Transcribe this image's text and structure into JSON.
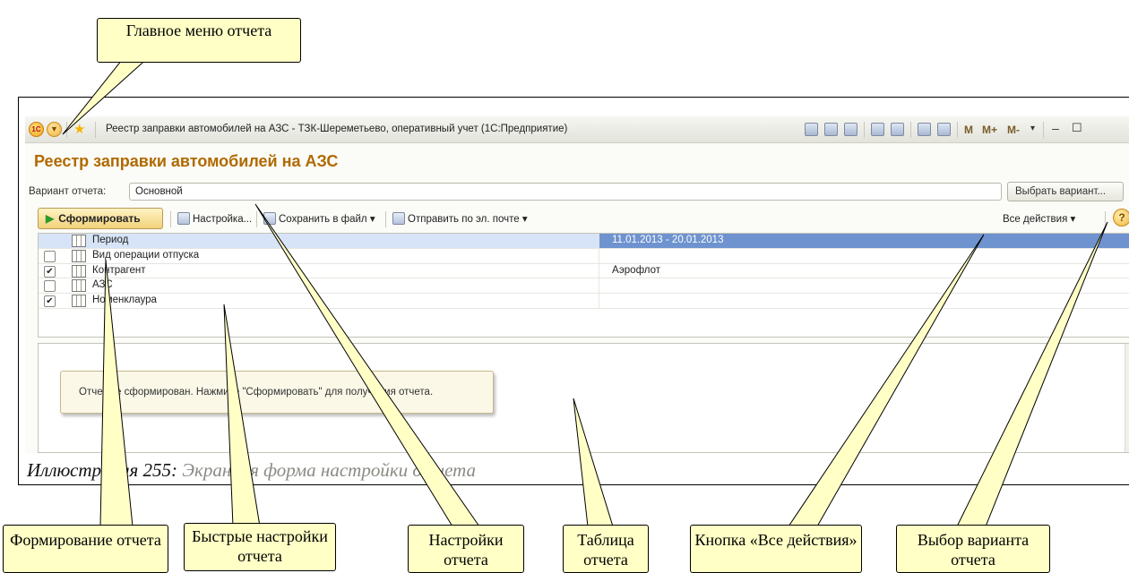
{
  "window": {
    "title": "Реестр заправки автомобилей на АЗС - ТЗК-Шереметьево, оперативный учет  (1С:Предприятие)",
    "logo_text": "1С",
    "memory_buttons": [
      "M",
      "M+",
      "M-"
    ]
  },
  "report": {
    "title": "Реестр заправки автомобилей на АЗС",
    "variant_label": "Вариант отчета:",
    "variant_value": "Основной",
    "choose_variant_button": "Выбрать вариант..."
  },
  "toolbar": {
    "form_button": "Сформировать",
    "settings_button": "Настройка...",
    "save_button": "Сохранить в файл",
    "email_button": "Отправить по эл. почте",
    "all_actions": "Все действия",
    "help": "?"
  },
  "settings": [
    {
      "name": "Период",
      "value": "11.01.2013 - 20.01.2013",
      "checkbox": false,
      "has_checkbox": false,
      "selected": true
    },
    {
      "name": "Вид операции отпуска",
      "value": "",
      "checkbox": false,
      "has_checkbox": true,
      "selected": false
    },
    {
      "name": "Контрагент",
      "value": "Аэрофлот",
      "checkbox": true,
      "has_checkbox": true,
      "selected": false
    },
    {
      "name": "АЗС",
      "value": "",
      "checkbox": false,
      "has_checkbox": true,
      "selected": false
    },
    {
      "name": "Номенклаура",
      "value": "",
      "checkbox": true,
      "has_checkbox": true,
      "selected": false
    }
  ],
  "result": {
    "notice": "Отчет не сформирован. Нажмите \"Сформировать\" для получения отчета."
  },
  "caption": {
    "prefix": "Иллюстрация 255:",
    "text": " Экранная форма настройки отчета"
  },
  "callouts": {
    "main_menu": "Главное меню отчета",
    "forming": "Формирование отчета",
    "quick_settings": "Быстрые настройки отчета",
    "settings": "Настройки отчета",
    "table": "Таблица отчета",
    "all_actions": "Кнопка «Все действия»",
    "variant_choice": "Выбор варианта отчета"
  },
  "colors": {
    "title_orange": "#b06a00",
    "callout_fill": "#ffffc6",
    "selected_value": "#6e93cf"
  }
}
